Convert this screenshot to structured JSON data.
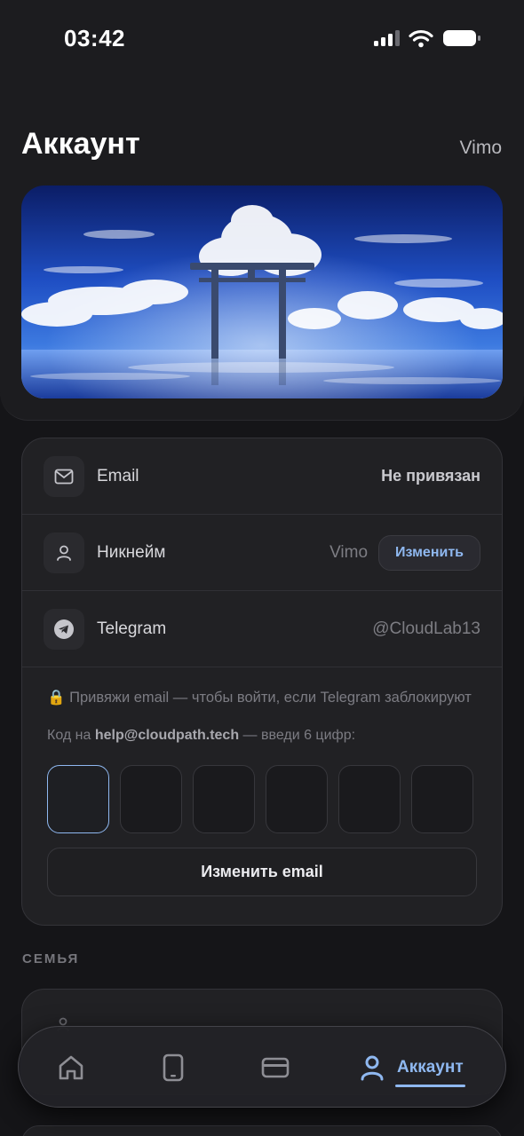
{
  "status_bar": {
    "time": "03:42"
  },
  "header": {
    "title": "Аккаунт",
    "username": "Vimo"
  },
  "account_rows": [
    {
      "label": "Email",
      "value": "Не привязан"
    },
    {
      "label": "Никнейм",
      "value": "Vimo",
      "button": "Изменить"
    },
    {
      "label": "Telegram",
      "value": "@CloudLab13"
    }
  ],
  "email_verify": {
    "hint_lock": "🔒",
    "hint": "Привяжи email — чтобы войти, если Telegram заблокируют",
    "code_prefix": "Код на ",
    "code_email": "help@cloudpath.tech",
    "code_suffix": " — введи 6 цифр:",
    "digits": [
      "",
      "",
      "",
      "",
      "",
      ""
    ],
    "change_button": "Изменить email"
  },
  "sections": {
    "family": "СЕМЬЯ"
  },
  "tab_bar": {
    "active_label": "Аккаунт"
  },
  "colors": {
    "accent": "#8fb8f0",
    "background": "#151518",
    "card": "#212124"
  }
}
